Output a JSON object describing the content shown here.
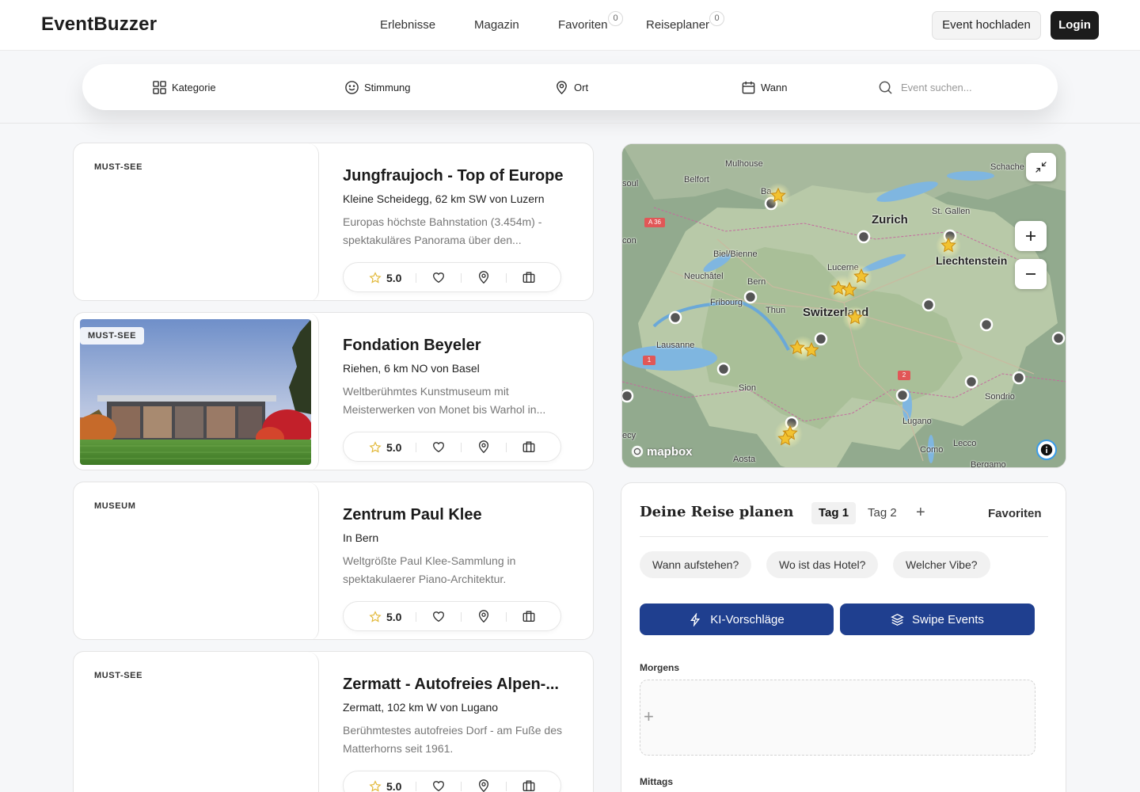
{
  "header": {
    "logo": "EventBuzzer",
    "nav": [
      {
        "label": "Erlebnisse"
      },
      {
        "label": "Magazin"
      },
      {
        "label": "Favoriten",
        "badge": "0"
      },
      {
        "label": "Reiseplaner",
        "badge": "0"
      }
    ],
    "upload_label": "Event hochladen",
    "login_label": "Login"
  },
  "filters": {
    "items": [
      {
        "label": "Kategorie",
        "icon": "grid-icon"
      },
      {
        "label": "Stimmung",
        "icon": "smiley-icon"
      },
      {
        "label": "Ort",
        "icon": "map-pin-icon"
      },
      {
        "label": "Wann",
        "icon": "calendar-icon"
      }
    ],
    "search_placeholder": "Event suchen..."
  },
  "events": [
    {
      "tag": "MUST-SEE",
      "title": "Jungfraujoch - Top of Europe",
      "location": "Kleine Scheidegg, 62 km SW von Luzern",
      "description": "Europas höchste Bahnstation (3.454m) - spektakuläres Panorama über den...",
      "rating": "5.0",
      "has_image": false
    },
    {
      "tag": "MUST-SEE",
      "title": "Fondation Beyeler",
      "location": "Riehen, 6 km NO von Basel",
      "description": "Weltberühmtes Kunstmuseum mit Meisterwerken von Monet bis Warhol in...",
      "rating": "5.0",
      "has_image": true
    },
    {
      "tag": "MUSEUM",
      "title": "Zentrum Paul Klee",
      "location": "In Bern",
      "description": "Weltgrößte Paul Klee-Sammlung in spektakulaerer Piano-Architektur.",
      "rating": "5.0",
      "has_image": false
    },
    {
      "tag": "MUST-SEE",
      "title": "Zermatt - Autofreies Alpen-...",
      "location": "Zermatt, 102 km W von Lugano",
      "description": "Berühmtestes autofreies Dorf - am Fuße des Matterhorns seit 1961.",
      "rating": "5.0",
      "has_image": false
    }
  ],
  "map": {
    "labels": {
      "mulhouse": "Mulhouse",
      "belfort": "Belfort",
      "ba": "Ba",
      "zurich": "Zurich",
      "st_gallen": "St. Gallen",
      "liechtenstein": "Liechtenstein",
      "schaffhausen": "Schache",
      "biel": "Biel/Bienne",
      "neuchatel": "Neuchâtel",
      "bern": "Bern",
      "lucerne": "Lucerne",
      "fribourg": "Fribourg",
      "thun": "Thun",
      "switzerland": "Switzerland",
      "lausanne": "Lausanne",
      "sion": "Sion",
      "lugano": "Lugano",
      "sondrio": "Sondrio",
      "lecco": "Lecco",
      "como": "Como",
      "aosta": "Aosta",
      "besoul": "soul",
      "con": "con",
      "ecy": "ecy",
      "gva": "va",
      "bergamo": "Bergamo"
    },
    "road_a36": "A 36",
    "road_1": "1",
    "road_2": "2",
    "attribution": "mapbox"
  },
  "planner": {
    "title": "Deine Reise planen",
    "tabs": [
      "Tag 1",
      "Tag 2"
    ],
    "add_tab": "+",
    "favorites_label": "Favoriten",
    "questions": [
      "Wann aufstehen?",
      "Wo ist das Hotel?",
      "Welcher Vibe?"
    ],
    "ai_button": "KI-Vorschläge",
    "swipe_button": "Swipe Events",
    "morning_label": "Morgens",
    "add_slot": "+",
    "noon_label": "Mittags"
  }
}
